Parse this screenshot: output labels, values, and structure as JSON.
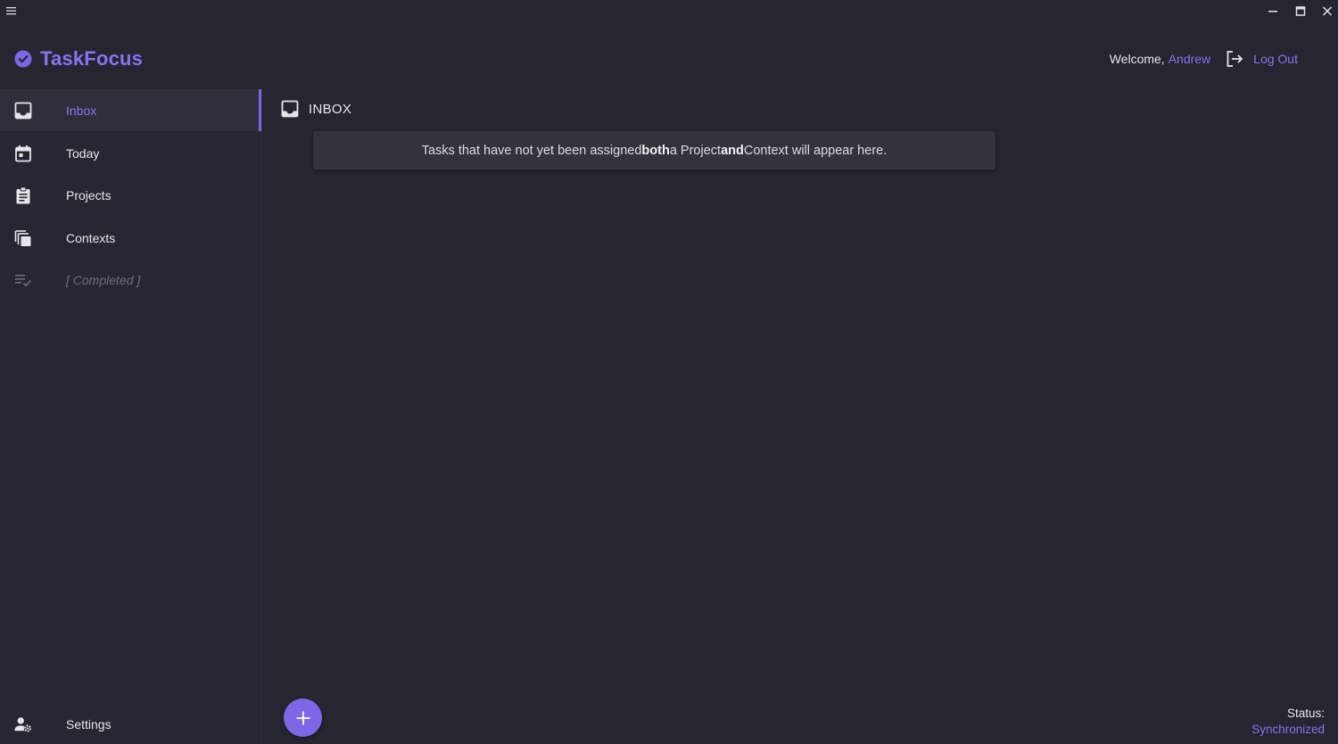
{
  "app": {
    "name": "TaskFocus",
    "accent_color": "#8a73f0",
    "background_color": "#262631"
  },
  "header": {
    "welcome_text": "Welcome,",
    "username": "Andrew",
    "logout_label": "Log Out"
  },
  "sidebar": {
    "items": [
      {
        "label": "Inbox",
        "icon": "inbox-icon",
        "active": true
      },
      {
        "label": "Today",
        "icon": "calendar-icon",
        "active": false
      },
      {
        "label": "Projects",
        "icon": "clipboard-icon",
        "active": false
      },
      {
        "label": "Contexts",
        "icon": "library-icon",
        "active": false
      },
      {
        "label": "[ Completed ]",
        "icon": "checklist-icon",
        "active": false
      }
    ],
    "settings_label": "Settings"
  },
  "main": {
    "title": "INBOX",
    "info_parts": [
      "Tasks that have not yet been assigned ",
      "both",
      " a Project ",
      "and",
      " Context will appear here."
    ]
  },
  "status": {
    "label": "Status:",
    "value": "Synchronized"
  }
}
